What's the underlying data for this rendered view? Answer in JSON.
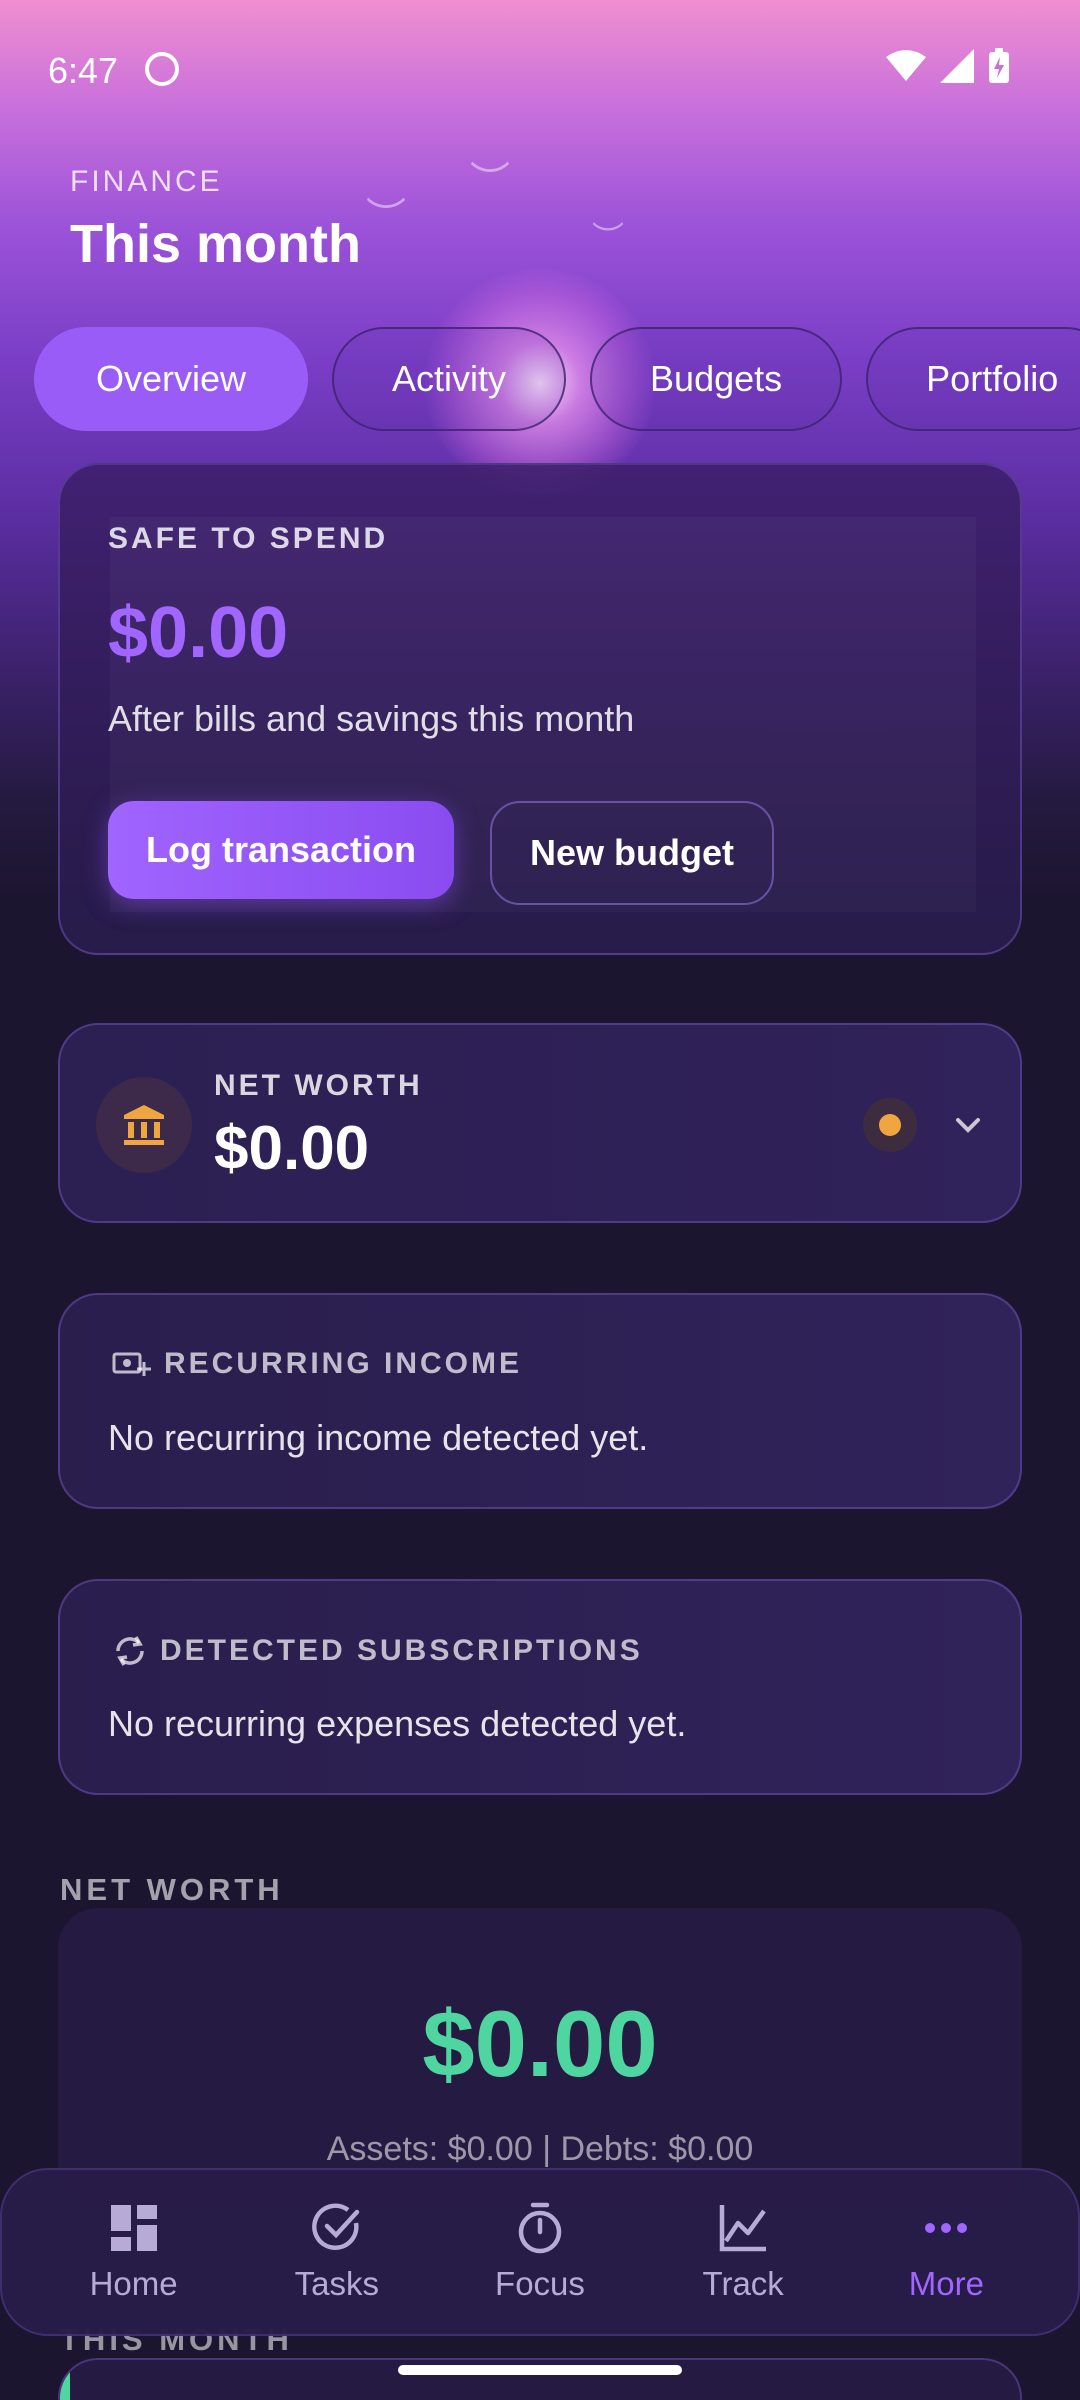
{
  "status_bar": {
    "time": "6:47"
  },
  "header": {
    "eyebrow": "FINANCE",
    "title": "This month"
  },
  "tabs": [
    {
      "label": "Overview",
      "active": true
    },
    {
      "label": "Activity",
      "active": false
    },
    {
      "label": "Budgets",
      "active": false
    },
    {
      "label": "Portfolio",
      "active": false
    }
  ],
  "safe_to_spend": {
    "label": "SAFE TO SPEND",
    "amount": "$0.00",
    "subtitle": "After bills and savings this month",
    "primary_button": "Log transaction",
    "secondary_button": "New budget"
  },
  "net_worth_card": {
    "label": "NET WORTH",
    "amount": "$0.00",
    "icon": "bank-icon",
    "status_color": "#f0a640"
  },
  "recurring_income": {
    "label": "RECURRING INCOME",
    "message": "No recurring income detected yet.",
    "icon": "payments-add-icon"
  },
  "detected_subscriptions": {
    "label": "DETECTED SUBSCRIPTIONS",
    "message": "No recurring expenses detected yet.",
    "icon": "sync-icon"
  },
  "net_worth_section": {
    "title": "NET WORTH",
    "amount": "$0.00",
    "breakdown": "Assets: $0.00 | Debts: $0.00",
    "amount_color": "#4fd6a0"
  },
  "this_month_section": {
    "title": "THIS MONTH"
  },
  "bottom_nav": [
    {
      "label": "Home",
      "icon": "dashboard-icon",
      "active": false
    },
    {
      "label": "Tasks",
      "icon": "check-circle-icon",
      "active": false
    },
    {
      "label": "Focus",
      "icon": "timer-icon",
      "active": false
    },
    {
      "label": "Track",
      "icon": "line-chart-icon",
      "active": false
    },
    {
      "label": "More",
      "icon": "more-dots-icon",
      "active": true
    }
  ],
  "colors": {
    "accent": "#a066ff",
    "positive": "#4fd6a0",
    "background": "#1c1530"
  }
}
